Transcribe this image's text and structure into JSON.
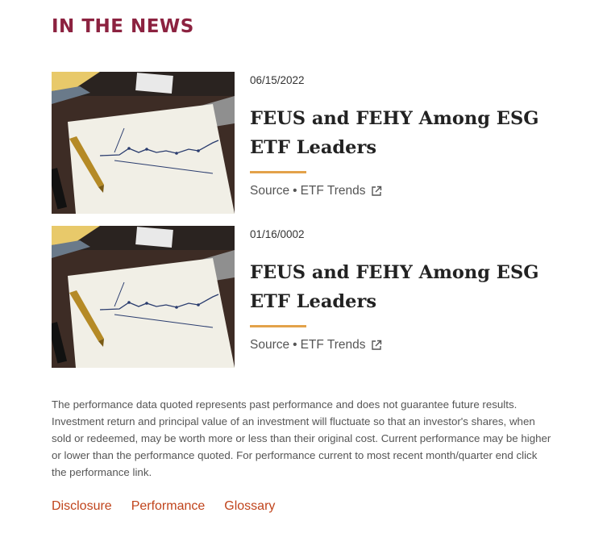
{
  "section": {
    "title": "IN THE NEWS"
  },
  "news": [
    {
      "date": "06/15/2022",
      "title": "FEUS and FEHY Among ESG ETF Leaders",
      "source_label": "Source",
      "separator": "•",
      "source_name": "ETF Trends",
      "image_icon": "chart-on-paper-photo",
      "link_icon": "external-link-icon"
    },
    {
      "date": "01/16/0002",
      "title": "FEUS and FEHY Among ESG ETF Leaders",
      "source_label": "Source",
      "separator": "•",
      "source_name": "ETF Trends",
      "image_icon": "chart-on-paper-photo",
      "link_icon": "external-link-icon"
    }
  ],
  "disclaimer": "The performance data quoted represents past performance and does not guarantee future results. Investment return and principal value of an investment will fluctuate so that an investor's shares, when sold or redeemed, may be worth more or less than their original cost. Current performance may be higher or lower than the performance quoted. For performance current to most recent month/quarter end click the performance link.",
  "footer_links": [
    "Disclosure",
    "Performance",
    "Glossary"
  ],
  "colors": {
    "title": "#8c2240",
    "accent_rule": "#e3a24a",
    "link": "#c0441c"
  }
}
